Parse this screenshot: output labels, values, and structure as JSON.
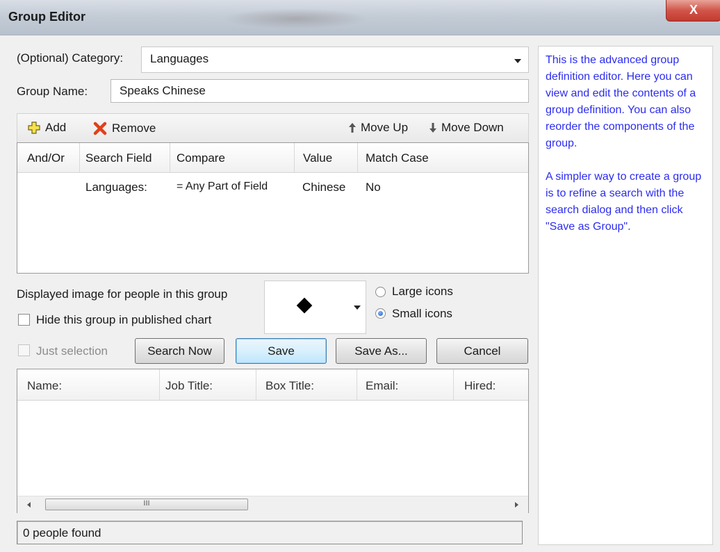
{
  "window": {
    "title": "Group Editor",
    "close": "X"
  },
  "form": {
    "category_label": "(Optional) Category:",
    "category_value": "Languages",
    "group_name_label": "Group Name:",
    "group_name_value": "Speaks Chinese"
  },
  "toolbar": {
    "add": "Add",
    "remove": "Remove",
    "move_up": "Move Up",
    "move_down": "Move Down"
  },
  "criteria_table": {
    "columns": [
      "And/Or",
      "Search Field",
      "Compare",
      "Value",
      "Match Case"
    ],
    "rows": [
      {
        "and_or": "",
        "search_field": "Languages:",
        "compare": "= Any Part of Field",
        "value": "Chinese",
        "match_case": "No"
      }
    ]
  },
  "display": {
    "image_label": "Displayed image for people in this group",
    "hide_label": "Hide this group in published chart",
    "hide_checked": false,
    "icon_symbol": "diamond",
    "large_icons": "Large icons",
    "small_icons": "Small icons",
    "selected_icon_size": "Small icons"
  },
  "actions": {
    "just_selection": "Just selection",
    "search_now": "Search Now",
    "save": "Save",
    "save_as": "Save As...",
    "cancel": "Cancel"
  },
  "results_table": {
    "columns": [
      "Name:",
      "Job Title:",
      "Box Title:",
      "Email:",
      "Hired:"
    ],
    "rows": [],
    "scroll_grip": "III"
  },
  "status": {
    "text": "0 people found"
  },
  "help": {
    "paragraph1": "This is the advanced group definition editor. Here you can view and edit the contents of a group definition. You can also reorder the components of the group.",
    "paragraph2": "A simpler way to create a group is to refine a search with the search dialog and then click \"Save as Group\".",
    "text_color": "#2c2cf0"
  }
}
